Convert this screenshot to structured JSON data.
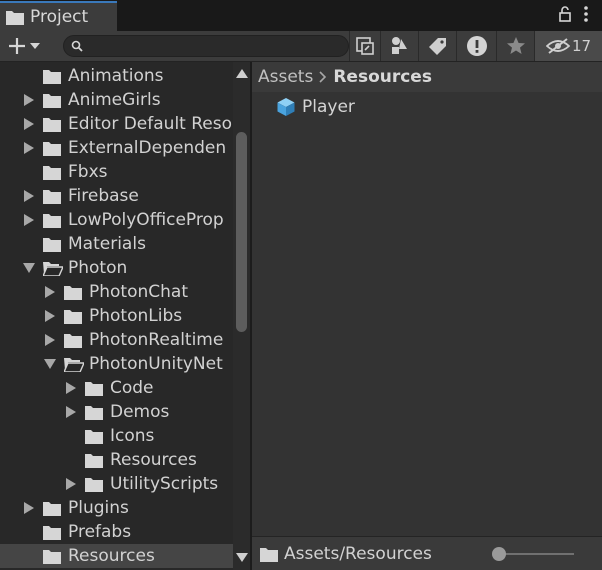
{
  "window": {
    "tab_title": "Project",
    "lock_icon": "lock-icon",
    "menu_icon": "kebab-menu-icon"
  },
  "toolbar": {
    "create_icon": "plus-icon",
    "search": {
      "placeholder": "",
      "value": ""
    },
    "buttons": [
      {
        "icon": "search-by-scene-icon"
      },
      {
        "icon": "search-by-type-icon"
      },
      {
        "icon": "search-by-label-icon"
      },
      {
        "icon": "log-types-icon"
      },
      {
        "icon": "favorites-star-icon"
      },
      {
        "icon": "hidden-packages-icon",
        "count": "17"
      }
    ]
  },
  "tree": {
    "items": [
      {
        "label": "Animations",
        "depth": 1,
        "expandable": false,
        "expanded": false
      },
      {
        "label": "AnimeGirls",
        "depth": 1,
        "expandable": true,
        "expanded": false
      },
      {
        "label": "Editor Default Reso",
        "depth": 1,
        "expandable": true,
        "expanded": false
      },
      {
        "label": "ExternalDependen",
        "depth": 1,
        "expandable": true,
        "expanded": false
      },
      {
        "label": "Fbxs",
        "depth": 1,
        "expandable": false,
        "expanded": false
      },
      {
        "label": "Firebase",
        "depth": 1,
        "expandable": true,
        "expanded": false
      },
      {
        "label": "LowPolyOfficeProp",
        "depth": 1,
        "expandable": true,
        "expanded": false
      },
      {
        "label": "Materials",
        "depth": 1,
        "expandable": false,
        "expanded": false
      },
      {
        "label": "Photon",
        "depth": 1,
        "expandable": true,
        "expanded": true
      },
      {
        "label": "PhotonChat",
        "depth": 2,
        "expandable": true,
        "expanded": false
      },
      {
        "label": "PhotonLibs",
        "depth": 2,
        "expandable": true,
        "expanded": false
      },
      {
        "label": "PhotonRealtime",
        "depth": 2,
        "expandable": true,
        "expanded": false
      },
      {
        "label": "PhotonUnityNet",
        "depth": 2,
        "expandable": true,
        "expanded": true
      },
      {
        "label": "Code",
        "depth": 3,
        "expandable": true,
        "expanded": false
      },
      {
        "label": "Demos",
        "depth": 3,
        "expandable": true,
        "expanded": false
      },
      {
        "label": "Icons",
        "depth": 3,
        "expandable": false,
        "expanded": false
      },
      {
        "label": "Resources",
        "depth": 3,
        "expandable": false,
        "expanded": false
      },
      {
        "label": "UtilityScripts",
        "depth": 3,
        "expandable": true,
        "expanded": false
      },
      {
        "label": "Plugins",
        "depth": 1,
        "expandable": true,
        "expanded": false
      },
      {
        "label": "Prefabs",
        "depth": 1,
        "expandable": false,
        "expanded": false
      },
      {
        "label": "Resources",
        "depth": 1,
        "expandable": false,
        "expanded": false,
        "selected": true
      }
    ]
  },
  "breadcrumb": {
    "items": [
      "Assets",
      "Resources"
    ],
    "separator_icon": "chevron-right-icon"
  },
  "assets": [
    {
      "label": "Player",
      "icon": "prefab-cube-icon"
    }
  ],
  "footer": {
    "path": "Assets/Resources",
    "zoom_slider": 0.0
  },
  "colors": {
    "accent": "#3a79bb",
    "prefab": "#5fb4e8",
    "selected_row": "#454545"
  }
}
